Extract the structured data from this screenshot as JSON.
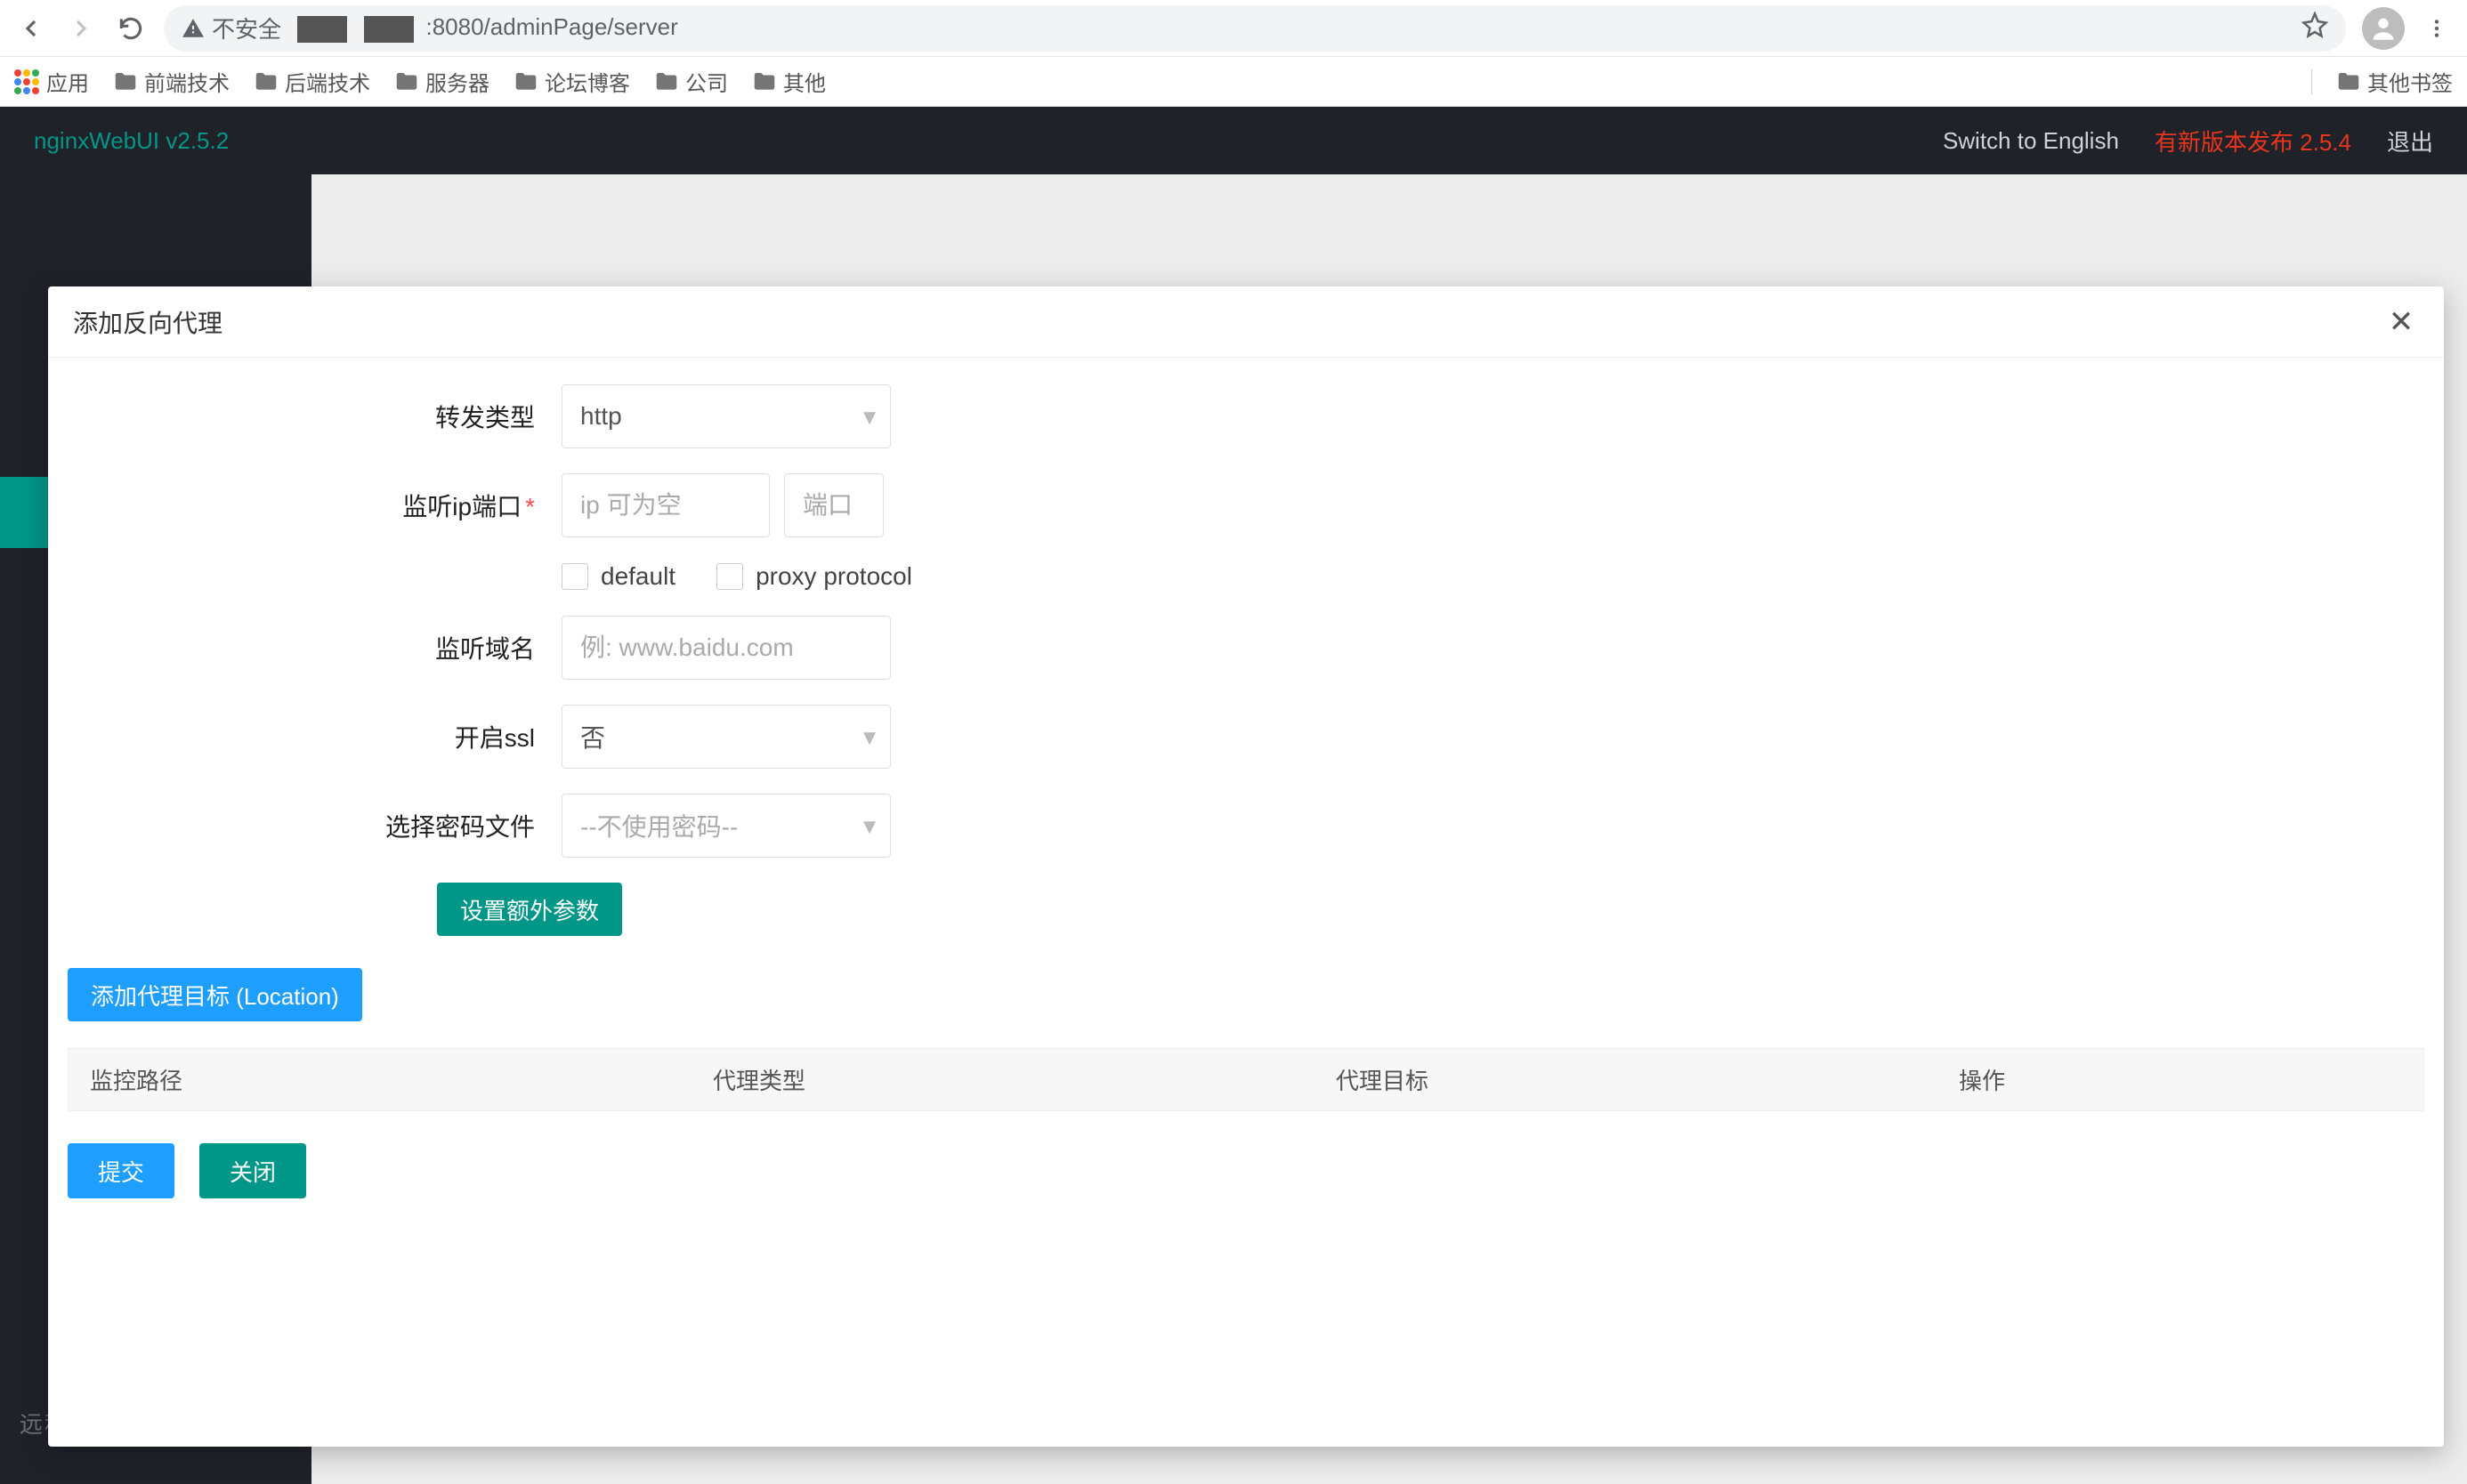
{
  "browser": {
    "insecure_label": "不安全",
    "url_suffix": ":8080/adminPage/server",
    "apps_label": "应用",
    "bookmarks": [
      "前端技术",
      "后端技术",
      "服务器",
      "论坛博客",
      "公司",
      "其他"
    ],
    "other_bookmarks": "其他书签"
  },
  "app": {
    "brand": "nginxWebUI v2.5.2",
    "switch_lang": "Switch to English",
    "new_version": "有新版本发布 2.5.4",
    "logout": "退出",
    "sidebar_label": "远程服务器"
  },
  "modal": {
    "title": "添加反向代理",
    "labels": {
      "forward_type": "转发类型",
      "listen_ip_port": "监听ip端口",
      "listen_domain": "监听域名",
      "enable_ssl": "开启ssl",
      "pwd_file": "选择密码文件"
    },
    "values": {
      "forward_type": "http",
      "ssl": "否",
      "pwd_file": "--不使用密码--"
    },
    "placeholders": {
      "ip": "ip 可为空",
      "port": "端口",
      "domain": "例: www.baidu.com"
    },
    "checkboxes": {
      "default": "default",
      "proxy_protocol": "proxy protocol"
    },
    "buttons": {
      "extra_params": "设置额外参数",
      "add_location": "添加代理目标 (Location)",
      "submit": "提交",
      "close": "关闭"
    },
    "table": {
      "col_path": "监控路径",
      "col_type": "代理类型",
      "col_target": "代理目标",
      "col_ops": "操作"
    }
  }
}
